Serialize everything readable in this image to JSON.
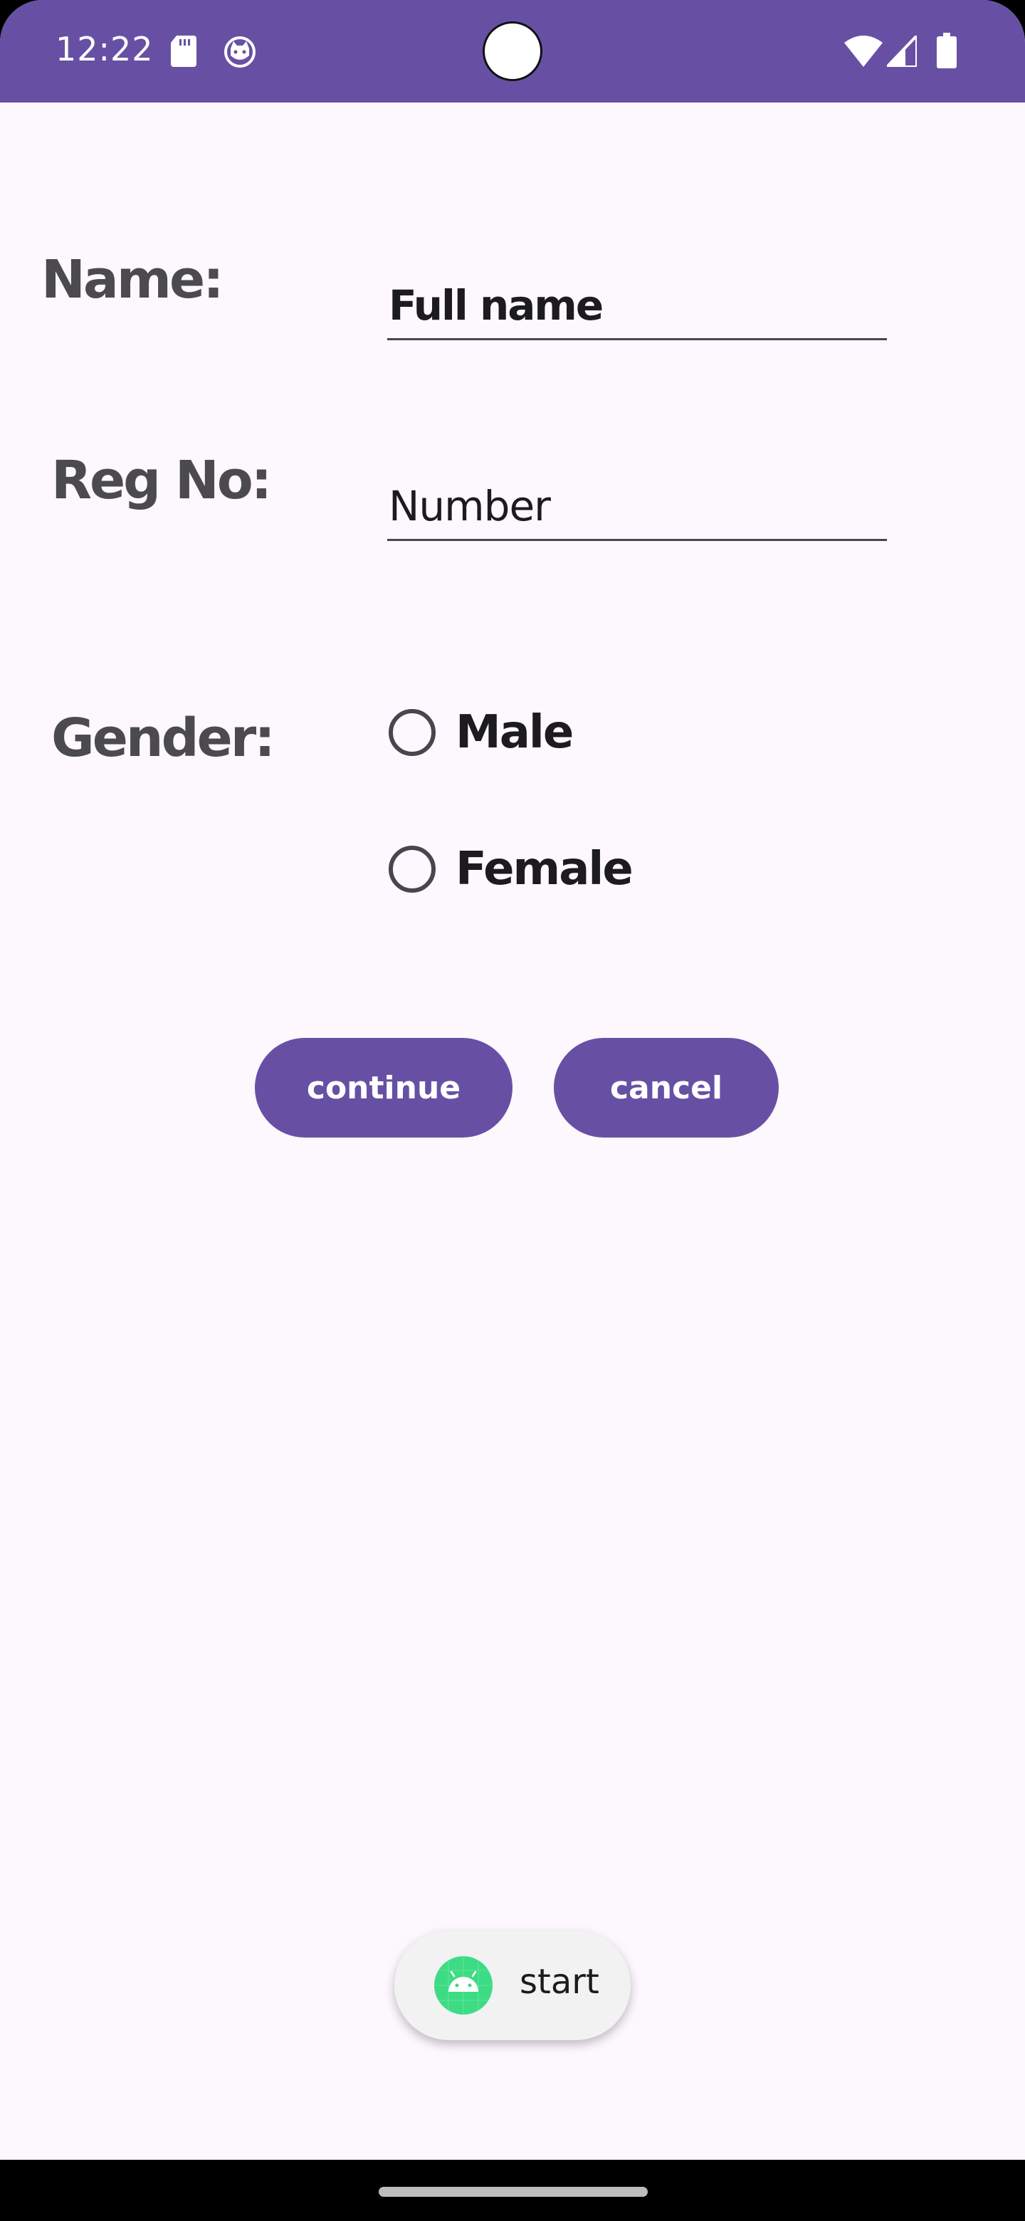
{
  "status_bar": {
    "time": "12:22",
    "icons": [
      "sd-card-icon",
      "cat-icon",
      "camera-cutout",
      "wifi-icon",
      "signal-icon",
      "battery-icon"
    ],
    "background": "#6750a4"
  },
  "form": {
    "name_label": "Name:",
    "name_value": "Full name",
    "reg_label": "Reg No:",
    "reg_placeholder": "Number",
    "gender_label": "Gender:",
    "gender_options": [
      {
        "label": "Male",
        "selected": false
      },
      {
        "label": "Female",
        "selected": false
      }
    ]
  },
  "buttons": {
    "continue_label": "continue",
    "cancel_label": "cancel"
  },
  "toast": {
    "text": "start",
    "icon": "android-icon"
  },
  "colors": {
    "accent": "#6750a4",
    "background": "#fdf7fe",
    "label_text": "#4b4b4d",
    "android_green": "#3ddc84"
  }
}
